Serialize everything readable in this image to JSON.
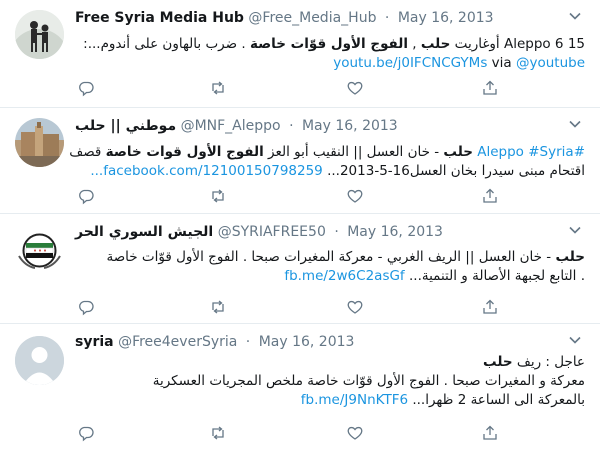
{
  "tweets": [
    {
      "name": "Free Syria Media Hub",
      "handle": "@Free_Media_Hub",
      "dot": "·",
      "date": "May 16, 2013",
      "lines": [
        [
          {
            "t": "Aleppo 6 15 أوغاريت ",
            "s": ""
          },
          {
            "t": "حلب",
            "s": "b"
          },
          {
            "t": " , ",
            "s": ""
          },
          {
            "t": "الفوج الأول قوّات خاصة",
            "s": "b"
          },
          {
            "t": " . ضرب بالهاون على أندوم...:",
            "s": ""
          }
        ],
        [
          {
            "t": "youtu.be/j0IFCNCGYMs",
            "s": "link"
          },
          {
            "t": " via ",
            "s": ""
          },
          {
            "t": "@youtube",
            "s": "link"
          }
        ]
      ]
    },
    {
      "name": "موطني || حلب",
      "handle": "@MNF_Aleppo",
      "dot": "·",
      "date": "May 16, 2013",
      "lines": [
        [
          {
            "t": "#Aleppo #Syria",
            "s": "link"
          },
          {
            "t": " ",
            "s": ""
          },
          {
            "t": "حلب",
            "s": "b"
          },
          {
            "t": " - خان العسل || النقيب أبو العز ",
            "s": ""
          },
          {
            "t": "الفوج الأول قوات خاصة",
            "s": "b"
          },
          {
            "t": " قصف",
            "s": ""
          }
        ],
        [
          {
            "t": "اقتحام مبنى سيدرا بخان العسل16-5-2013...",
            "s": ""
          },
          {
            "t": " facebook.com/12100150798259...",
            "s": "link"
          }
        ]
      ]
    },
    {
      "name": "الجيش السوري الحر",
      "handle": "@SYRIAFREE50",
      "dot": "·",
      "date": "May 16, 2013",
      "lines": [
        [
          {
            "t": "حلب",
            "s": "b"
          },
          {
            "t": " - خان العسل || الريف الغربي - معركة المغيرات صبحا . الفوج الأول قوّات خاصة",
            "s": ""
          }
        ],
        [
          {
            "t": ". التابع لجبهة الأصالة و التنمية...",
            "s": ""
          },
          {
            "t": " fb.me/2w6C2asGf",
            "s": "link"
          }
        ]
      ]
    },
    {
      "name": "syria",
      "handle": "@Free4everSyria",
      "dot": "·",
      "date": "May 16, 2013",
      "lines": [
        [
          {
            "t": "عاجل : ريف ",
            "s": ""
          },
          {
            "t": "حلب",
            "s": "b"
          }
        ],
        [
          {
            "t": "معركة و المغيرات صبحا . الفوج الأول قوّات خاصة ملخص المجريات العسكرية",
            "s": ""
          }
        ],
        [
          {
            "t": "بالمعركة الى الساعة 2 ظهرا...",
            "s": ""
          },
          {
            "t": " fb.me/J9NnKTF6",
            "s": "link"
          }
        ]
      ]
    }
  ],
  "icons": {
    "reply": "reply-icon",
    "retweet": "retweet-icon",
    "like": "like-icon",
    "share": "share-icon",
    "more": "chevron-down-icon"
  },
  "colors": {
    "link": "#1b95e0",
    "muted": "#657786",
    "border": "#e6ecf0",
    "text": "#14171a"
  }
}
